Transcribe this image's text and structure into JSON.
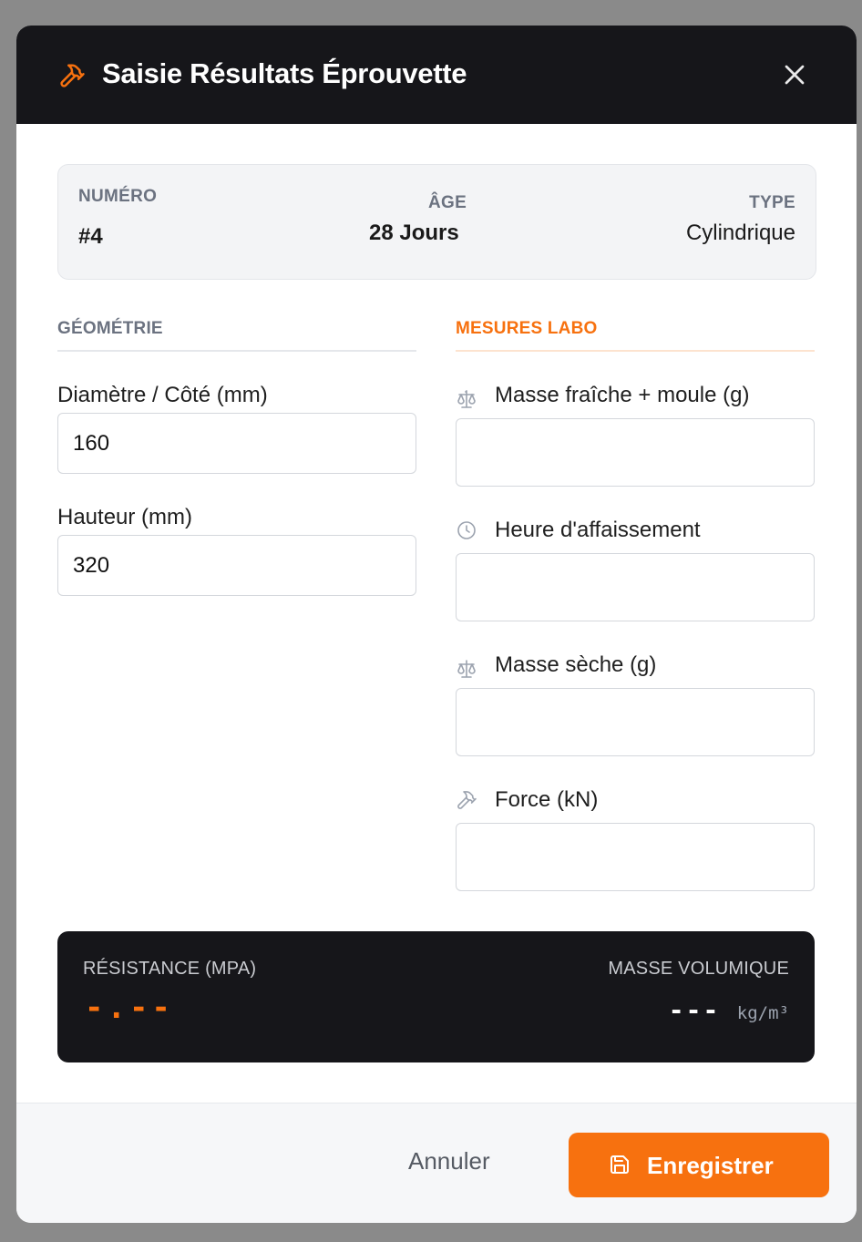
{
  "dialog": {
    "title": "Saisie Résultats Éprouvette",
    "icon": "hammer-icon",
    "close_icon": "close-icon"
  },
  "info": {
    "numero_label": "NUMÉRO",
    "numero_value": "#4",
    "age_label": "ÂGE",
    "age_value": "28 Jours",
    "type_label": "TYPE",
    "type_value": "Cylindrique"
  },
  "geometry": {
    "section_title": "GÉOMÉTRIE",
    "diameter_label": "Diamètre / Côté (mm)",
    "diameter_value": "160",
    "height_label": "Hauteur (mm)",
    "height_value": "320"
  },
  "lab": {
    "section_title": "MESURES LABO",
    "fresh_mass_label": "Masse fraîche + moule (g)",
    "fresh_mass_value": "",
    "slump_time_label": "Heure d'affaissement",
    "slump_time_value": "",
    "dry_mass_label": "Masse sèche (g)",
    "dry_mass_value": "",
    "force_label": "Force (kN)",
    "force_value": ""
  },
  "results": {
    "resistance_label": "RÉSISTANCE (MPA)",
    "resistance_value": "-.--",
    "density_label": "MASSE VOLUMIQUE",
    "density_value": "---",
    "density_unit": "kg/m³"
  },
  "footer": {
    "cancel_label": "Annuler",
    "save_label": "Enregistrer"
  },
  "colors": {
    "accent": "#f7710f",
    "dark": "#16161a"
  }
}
